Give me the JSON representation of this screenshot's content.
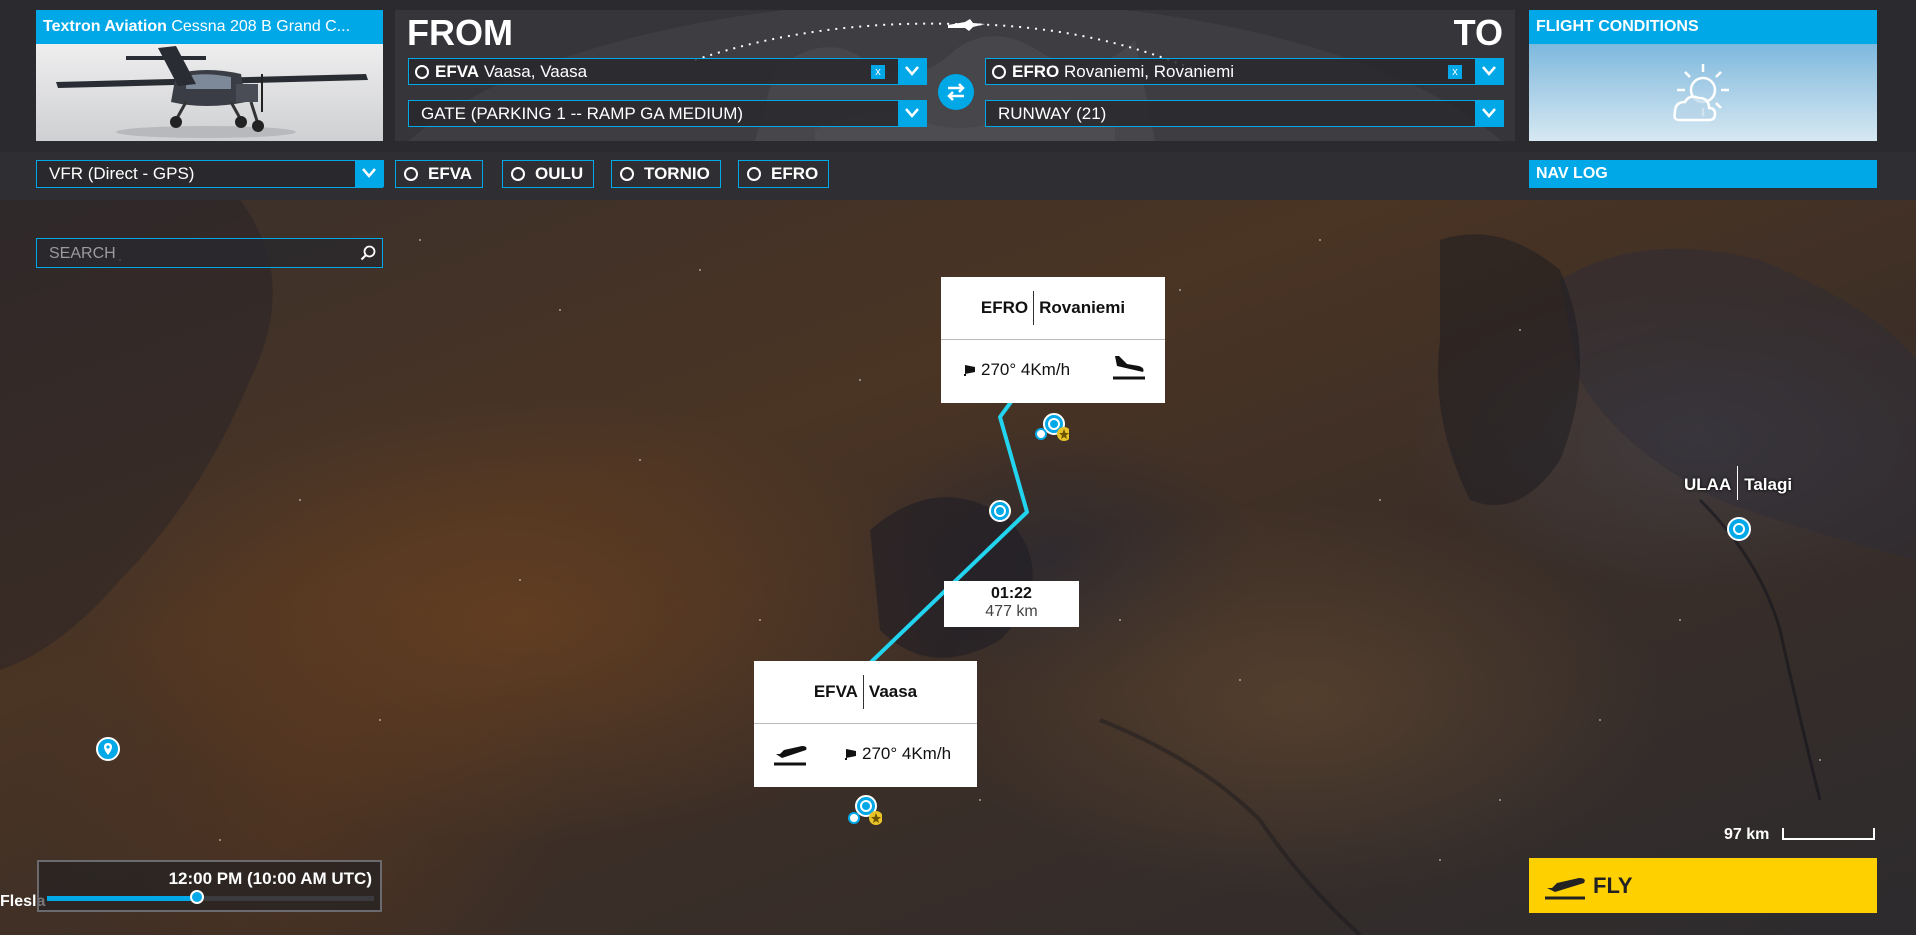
{
  "aircraft": {
    "manufacturer": "Textron Aviation",
    "model": "Cessna 208 B Grand C..."
  },
  "route": {
    "from_label": "FROM",
    "to_label": "TO",
    "departure": {
      "code": "EFVA",
      "name": "Vaasa, Vaasa",
      "position": "GATE (PARKING 1 -- RAMP GA MEDIUM)"
    },
    "arrival": {
      "code": "EFRO",
      "name": "Rovaniemi, Rovaniemi",
      "position": "RUNWAY (21)"
    },
    "clear_label": "x"
  },
  "conditions": {
    "title": "FLIGHT CONDITIONS"
  },
  "flight_plan": {
    "type": "VFR (Direct - GPS)",
    "waypoints": [
      "EFVA",
      "OULU",
      "TORNIO",
      "EFRO"
    ],
    "nav_log_label": "NAV LOG"
  },
  "search": {
    "placeholder": "SEARCH"
  },
  "map": {
    "arrival_popup": {
      "code": "EFRO",
      "name": "Rovaniemi",
      "wind": "270° 4Km/h"
    },
    "departure_popup": {
      "code": "EFVA",
      "name": "Vaasa",
      "wind": "270° 4Km/h"
    },
    "leg": {
      "time": "01:22",
      "distance": "477 km"
    },
    "other_airport": {
      "code": "ULAA",
      "name": "Talagi"
    },
    "edge_label": "Flesla",
    "scale": "97 km"
  },
  "time": {
    "label": "12:00 PM (10:00 AM UTC)",
    "slider_fraction": 0.46
  },
  "fly": {
    "label": "FLY"
  },
  "colors": {
    "accent": "#00a8e8",
    "fly": "#ffd000",
    "route_line": "#22d4f0"
  }
}
